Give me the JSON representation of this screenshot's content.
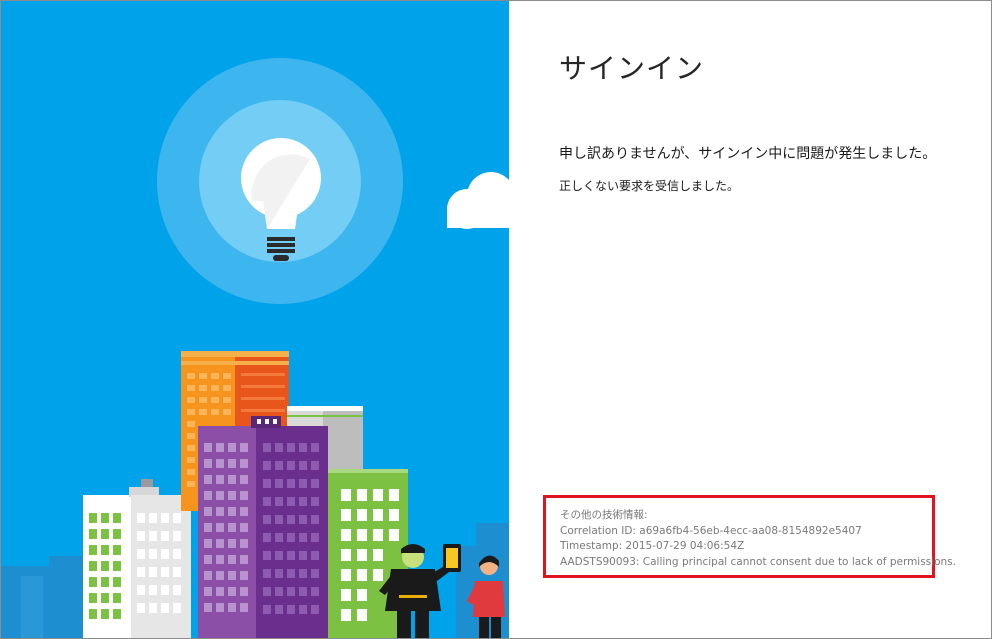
{
  "page": {
    "title": "サインイン",
    "error_message": "申し訳ありませんが、サインイン中に問題が発生しました。",
    "error_detail": "正しくない要求を受信しました。"
  },
  "technical_info": {
    "heading": "その他の技術情報:",
    "correlation_id": "Correlation ID: a69a6fb4-56eb-4ecc-aa08-8154892e5407",
    "timestamp": "Timestamp: 2015-07-29 04:06:54Z",
    "error_code": "AADSTS90093: Calling principal cannot consent due to lack of permissions."
  },
  "colors": {
    "sky": "#00a2ea",
    "highlight_border": "#e0141e",
    "title_text": "#262626",
    "tech_text": "#7a7a7a"
  },
  "icons": [
    "lightbulb-icon",
    "cloud-icon"
  ]
}
